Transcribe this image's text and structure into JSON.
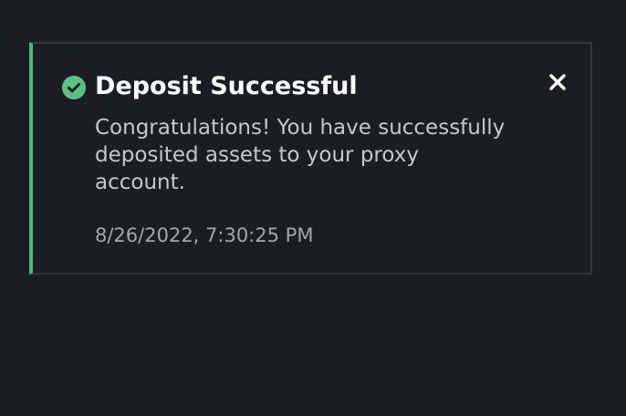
{
  "notification": {
    "status_icon": "check-circle-icon",
    "title": "Deposit Successful",
    "message": "Congratulations! You have successfully deposited assets to your proxy account.",
    "timestamp": "8/26/2022, 7:30:25 PM",
    "close_icon": "close-icon",
    "colors": {
      "accent": "#4fb87a",
      "background": "#1c1d24",
      "border": "#34363f"
    }
  }
}
